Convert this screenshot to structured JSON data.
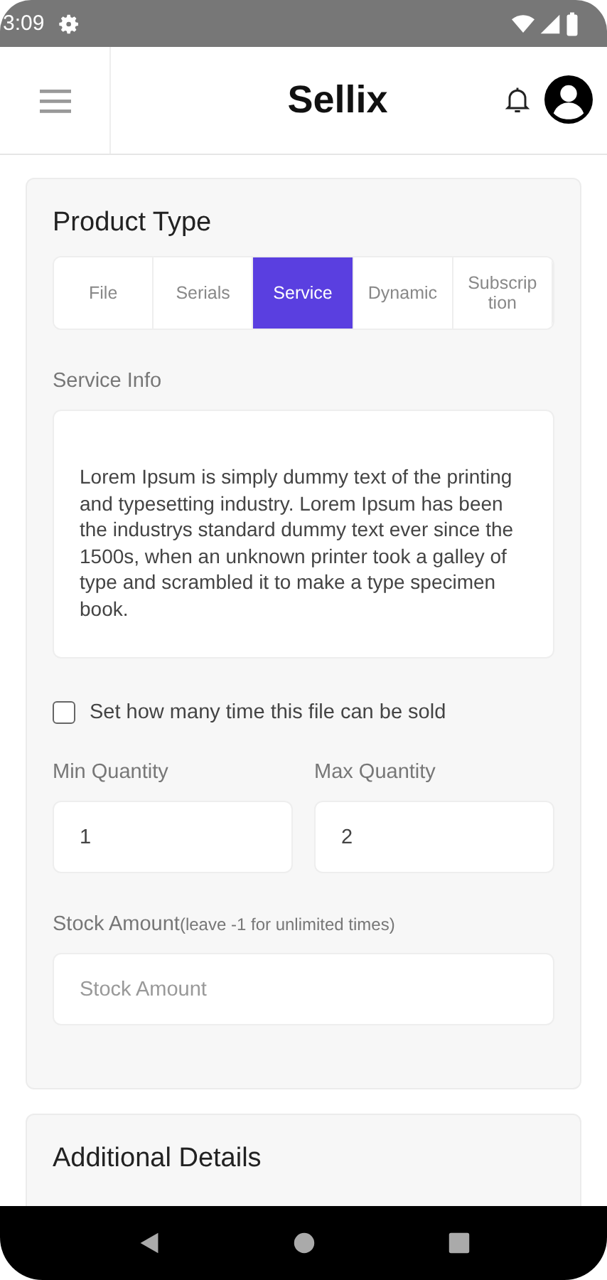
{
  "status_bar": {
    "time": "3:09"
  },
  "header": {
    "title": "Sellix"
  },
  "product_type": {
    "title": "Product Type",
    "tabs": [
      {
        "label": "File",
        "selected": false
      },
      {
        "label": "Serials",
        "selected": false
      },
      {
        "label": "Service",
        "selected": true
      },
      {
        "label": "Dynamic",
        "selected": false
      },
      {
        "label": "Subscrip tion",
        "selected": false
      }
    ],
    "service_info": {
      "label": "Service Info",
      "value": "Lorem Ipsum is simply dummy text of the printing and typesetting industry. Lorem Ipsum has been the industrys standard dummy text ever since the 1500s, when an unknown printer took a galley of type and scrambled it to make a type specimen book."
    },
    "limit_checkbox": {
      "label": "Set how many time this file can be sold",
      "checked": false
    },
    "min_quantity": {
      "label": "Min Quantity",
      "value": "1"
    },
    "max_quantity": {
      "label": "Max Quantity",
      "value": "2"
    },
    "stock_amount": {
      "label": "Stock Amount",
      "hint": "(leave -1 for unlimited times)",
      "placeholder": "Stock Amount"
    }
  },
  "additional_details": {
    "title": "Additional Details"
  }
}
